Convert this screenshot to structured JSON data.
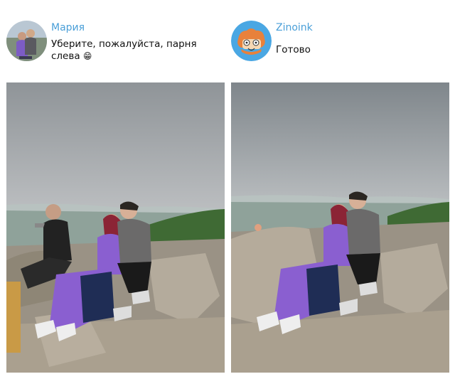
{
  "messages": [
    {
      "author": "Мария",
      "text": "Уберите, пожалуйста, парня слева",
      "emoji": "😁"
    },
    {
      "author": "Zinoink",
      "text": "Готово"
    }
  ],
  "colors": {
    "author_name": "#4a9fd8",
    "zinoink_avatar_bg": "#4aa7e3",
    "sky": "#c9cbcd",
    "rocks": "#a9a090",
    "purple_outfit": "#8a5fd0"
  }
}
